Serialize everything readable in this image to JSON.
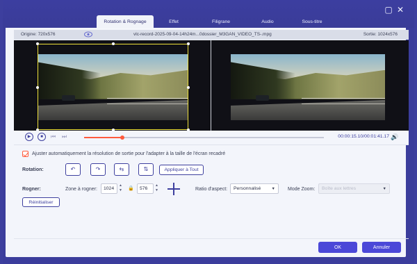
{
  "tabs": [
    {
      "label": "Rotation & Rognage"
    },
    {
      "label": "Effet"
    },
    {
      "label": "Filigrane"
    },
    {
      "label": "Audio"
    },
    {
      "label": "Sous-titre"
    }
  ],
  "window_controls": {
    "minimize_icon": "minimize-icon",
    "close_icon": "close-icon"
  },
  "infobar": {
    "origin": "Origine: 720x576",
    "filename": "vlc-record-2025-09-04-14h24m...0dossier_M3GAN_VIDEO_TS-.mpg",
    "output": "Sortie: 1024x576"
  },
  "playback": {
    "time": "00:00:15.10/00:01:41.17",
    "progress": 0.16
  },
  "auto_adjust": {
    "label": "Ajuster automatiquement la résolution de sortie pour l'adapter à la taille de l'écran recadré",
    "checked": true
  },
  "rotation": {
    "label": "Rotation:",
    "apply_all": "Appliquer à Tout"
  },
  "crop": {
    "label": "Rogner:",
    "zone_label": "Zone à rogner:",
    "width": "1024",
    "height": "576",
    "ratio_label": "Ratio d'aspect:",
    "ratio_value": "Personnalisé",
    "zoom_label": "Mode Zoom:",
    "zoom_value": "Boîte aux lettres",
    "reset": "Réinitialiser"
  },
  "footer": {
    "ok": "OK",
    "cancel": "Annuler"
  },
  "colors": {
    "brand": "#3d3f9e",
    "accent": "#ff5a3c",
    "button": "#4b48d8",
    "crop_border": "#f0e23b"
  }
}
